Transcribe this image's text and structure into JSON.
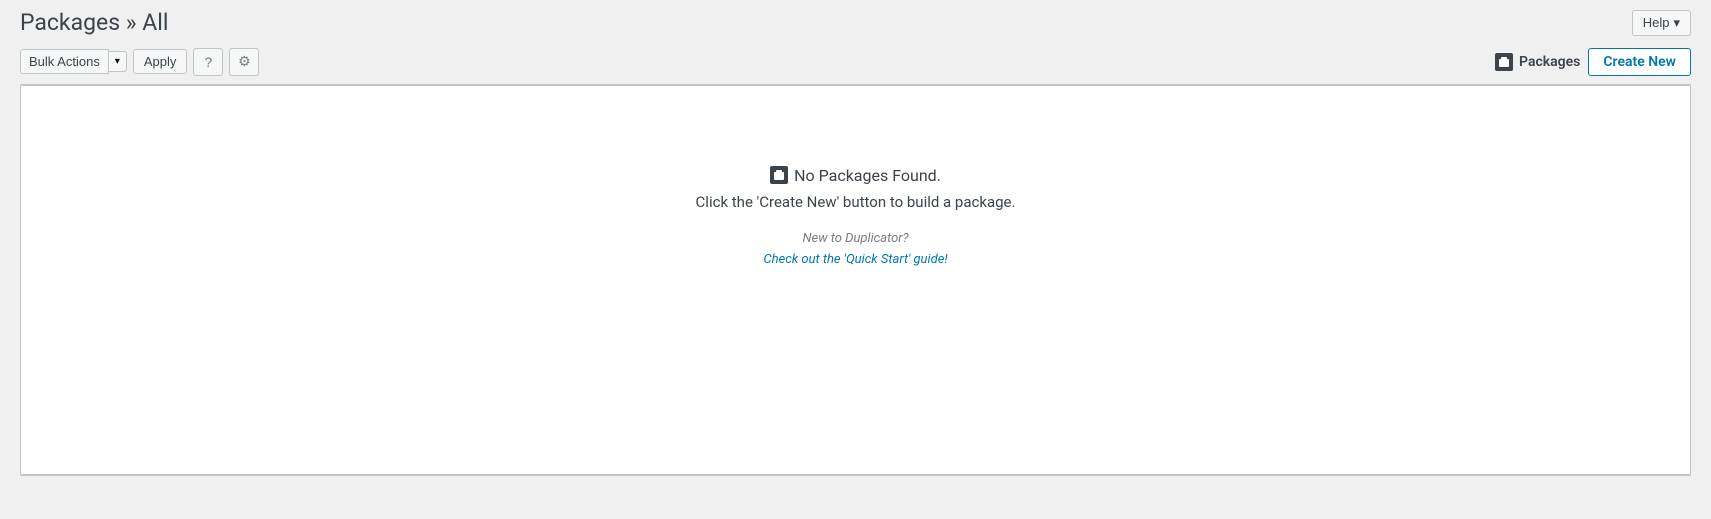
{
  "header": {
    "title": "Packages » All",
    "help_label": "Help"
  },
  "toolbar": {
    "bulk_actions_label": "Bulk Actions",
    "apply_label": "Apply",
    "help_icon": "?",
    "settings_icon": "⚙",
    "packages_label": "Packages",
    "create_new_label": "Create New"
  },
  "empty_state": {
    "icon_label": "📦",
    "title": "No Packages Found.",
    "subtitle": "Click the 'Create New' button to build a package.",
    "hint": "New to Duplicator?",
    "link_text": "Check out the 'Quick Start' guide!"
  }
}
